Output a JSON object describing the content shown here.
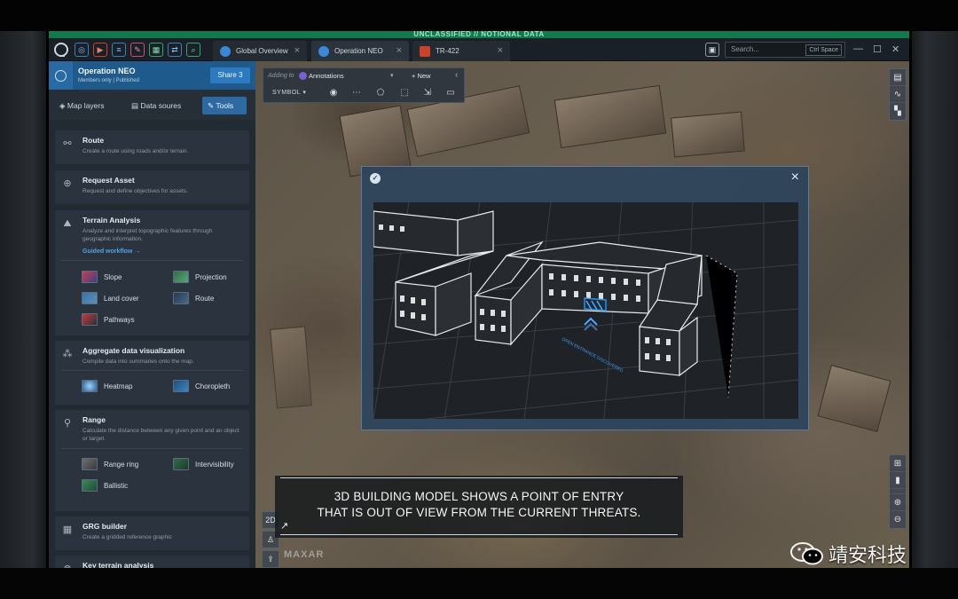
{
  "banner": {
    "classification": "UNCLASSIFIED // NOTIONAL DATA"
  },
  "topbar": {
    "tabs": [
      {
        "label": "Global Overview"
      },
      {
        "label": "Operation NEO"
      },
      {
        "label": "TR-422"
      }
    ],
    "search": {
      "placeholder": "Search...",
      "shortcut": "Ctrl Space"
    }
  },
  "sidebar": {
    "title": "Operation NEO",
    "subtitle": "Members only | Published",
    "share_label": "Share",
    "share_count": "3",
    "tabs": [
      {
        "label": "Map layers"
      },
      {
        "label": "Data soures"
      },
      {
        "label": "Tools"
      }
    ],
    "cards": {
      "route": {
        "title": "Route",
        "desc": "Create a route using roads and/or terrain."
      },
      "request": {
        "title": "Request Asset",
        "desc": "Request and define objectives for assets."
      },
      "terrain": {
        "title": "Terrain Analysis",
        "desc": "Analyze and interpret topographic features through geographic information.",
        "link": "Guided workflow →",
        "items": [
          "Slope",
          "Projection",
          "Land cover",
          "Route",
          "Pathways"
        ]
      },
      "aggregate": {
        "title": "Aggregate data visualization",
        "desc": "Compile data into summaries onto the map.",
        "items": [
          "Heatmap",
          "Choropleth"
        ]
      },
      "range": {
        "title": "Range",
        "desc": "Calculate the distance between any given point and an object or target.",
        "items": [
          "Range ring",
          "Intervisibility",
          "Ballistic"
        ]
      },
      "grg": {
        "title": "GRG builder",
        "desc": "Create a gridded reference graphic"
      },
      "keyterrain": {
        "title": "Key terrain analysis"
      }
    }
  },
  "annotation_bar": {
    "adding_to": "Adding to",
    "layer": "Annotations",
    "new_label": "+ New",
    "symbol_label": "SYMBOL"
  },
  "viewport_label": "OPEN ENTRANCE DISCOVERED",
  "caption": {
    "line1": "3D BUILDING MODEL SHOWS A POINT OF ENTRY",
    "line2": "THAT IS OUT OF VIEW FROM THE CURRENT THREATS."
  },
  "map": {
    "attribution": "MAXAR",
    "scale_label": "2D"
  },
  "watermark": {
    "text": "靖安科技"
  },
  "colors": {
    "accent": "#2d7ac0",
    "banner": "#0f7a4e",
    "highlight": "#2f8fe0"
  }
}
